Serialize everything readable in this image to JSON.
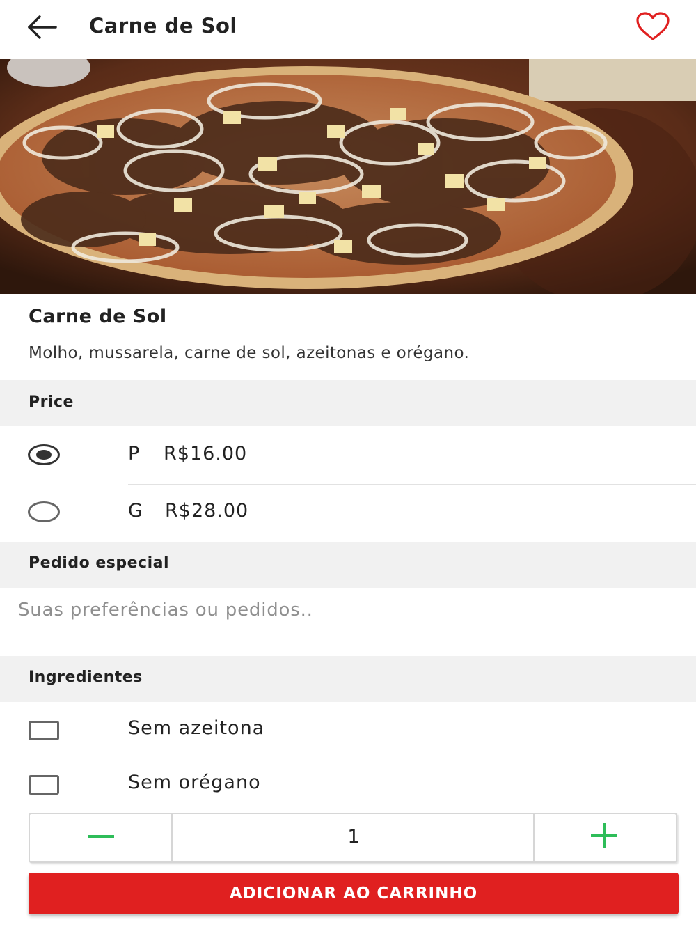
{
  "header": {
    "title": "Carne de Sol",
    "back_icon": "arrow-left-icon",
    "favorite_icon": "heart-outline-icon",
    "favorite_color": "#e02020"
  },
  "product": {
    "image": "pizza-photo",
    "name": "Carne de Sol",
    "description": "Molho, mussarela, carne de sol, azeitonas e orégano."
  },
  "price_section": {
    "title": "Price",
    "options": [
      {
        "size": "P",
        "price": "R$16.00",
        "selected": true
      },
      {
        "size": "G",
        "price": "R$28.00",
        "selected": false
      }
    ]
  },
  "special_request": {
    "title": "Pedido especial",
    "placeholder": "Suas preferências ou pedidos..",
    "value": ""
  },
  "ingredients": {
    "title": "Ingredientes",
    "options": [
      {
        "label": "Sem azeitona",
        "checked": false
      },
      {
        "label": "Sem orégano",
        "checked": false
      }
    ]
  },
  "quantity": {
    "value": "1",
    "minus_icon": "minus-icon",
    "plus_icon": "plus-icon",
    "icon_color": "#2ebd59"
  },
  "cart_button": {
    "label": "ADICIONAR AO CARRINHO",
    "color": "#e02020"
  }
}
